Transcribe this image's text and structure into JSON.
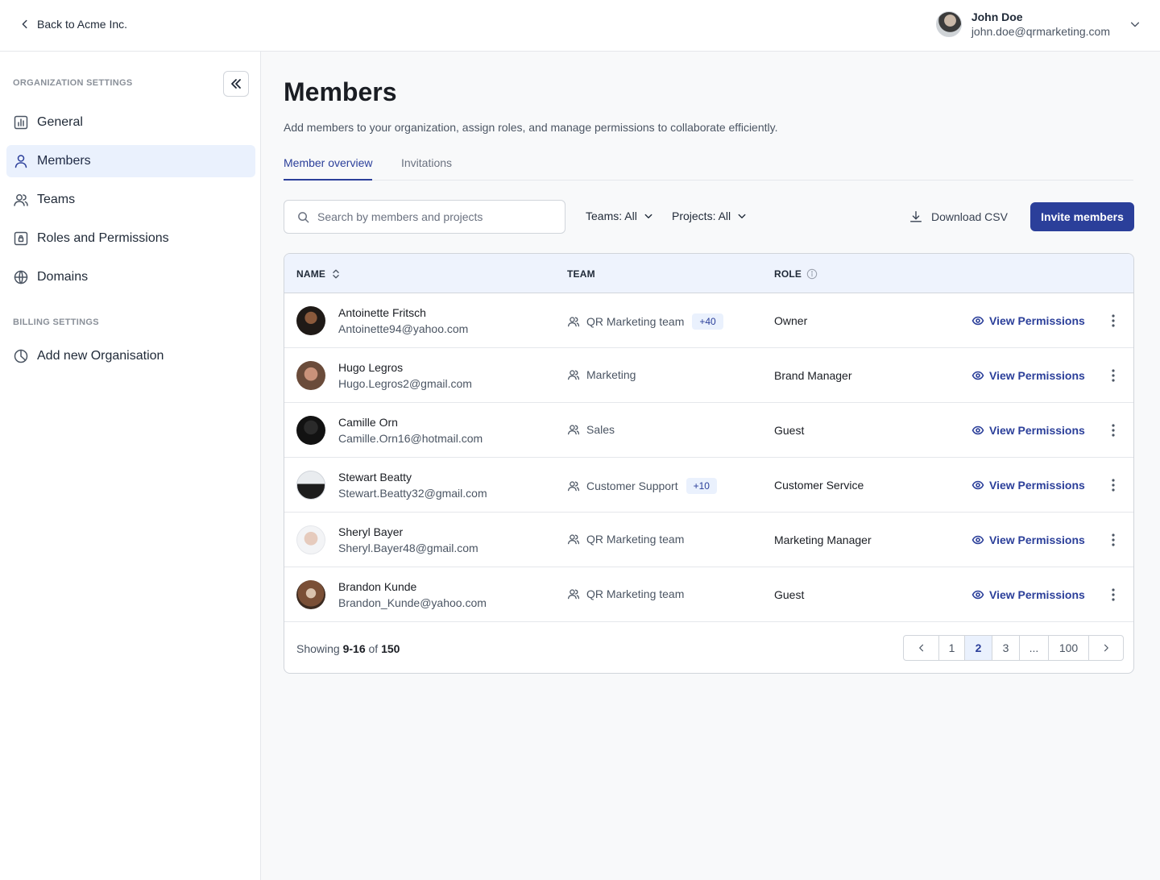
{
  "header": {
    "back_label": "Back to Acme Inc.",
    "user_name": "John Doe",
    "user_email": "john.doe@qrmarketing.com"
  },
  "sidebar": {
    "org_section_label": "ORGANIZATION SETTINGS",
    "billing_section_label": "BILLING SETTINGS",
    "items": [
      {
        "label": "General",
        "icon": "chart-icon"
      },
      {
        "label": "Members",
        "icon": "user-icon",
        "active": true
      },
      {
        "label": "Teams",
        "icon": "users-icon"
      },
      {
        "label": "Roles and Permissions",
        "icon": "lock-icon"
      },
      {
        "label": "Domains",
        "icon": "globe-icon"
      }
    ],
    "billing_items": [
      {
        "label": "Add new Organisation",
        "icon": "pie-chart-icon"
      }
    ]
  },
  "main": {
    "title": "Members",
    "description": "Add members to your organization, assign roles, and manage permissions to collaborate efficiently.",
    "tabs": [
      {
        "label": "Member overview",
        "active": true
      },
      {
        "label": "Invitations"
      }
    ],
    "search_placeholder": "Search by members and projects",
    "filter_teams": "Teams: All",
    "filter_projects": "Projects: All",
    "download_label": "Download CSV",
    "invite_label": "Invite members"
  },
  "table": {
    "headers": {
      "name": "NAME",
      "team": "TEAM",
      "role": "ROLE"
    },
    "action_label": "View Permissions",
    "rows": [
      {
        "name": "Antoinette Fritsch",
        "email": "Antoinette94@yahoo.com",
        "team": "QR Marketing team",
        "badge": "+40",
        "role": "Owner"
      },
      {
        "name": "Hugo Legros",
        "email": "Hugo.Legros2@gmail.com",
        "team": "Marketing",
        "badge": "",
        "role": "Brand Manager"
      },
      {
        "name": "Camille Orn",
        "email": "Camille.Orn16@hotmail.com",
        "team": "Sales",
        "badge": "",
        "role": "Guest"
      },
      {
        "name": "Stewart Beatty",
        "email": "Stewart.Beatty32@gmail.com",
        "team": "Customer Support",
        "badge": "+10",
        "role": "Customer Service"
      },
      {
        "name": "Sheryl Bayer",
        "email": "Sheryl.Bayer48@gmail.com",
        "team": "QR Marketing team",
        "badge": "",
        "role": "Marketing Manager"
      },
      {
        "name": "Brandon Kunde",
        "email": "Brandon_Kunde@yahoo.com",
        "team": "QR Marketing team",
        "badge": "",
        "role": "Guest"
      }
    ],
    "footer": {
      "showing_prefix": "Showing",
      "range": "9-16",
      "of": "of",
      "total": "150"
    },
    "pages": [
      "1",
      "2",
      "3",
      "...",
      "100"
    ],
    "current_page": "2"
  },
  "colors": {
    "accent": "#2b3f9a",
    "active_bg": "#eaf1fd",
    "header_bg": "#eef3fd"
  }
}
